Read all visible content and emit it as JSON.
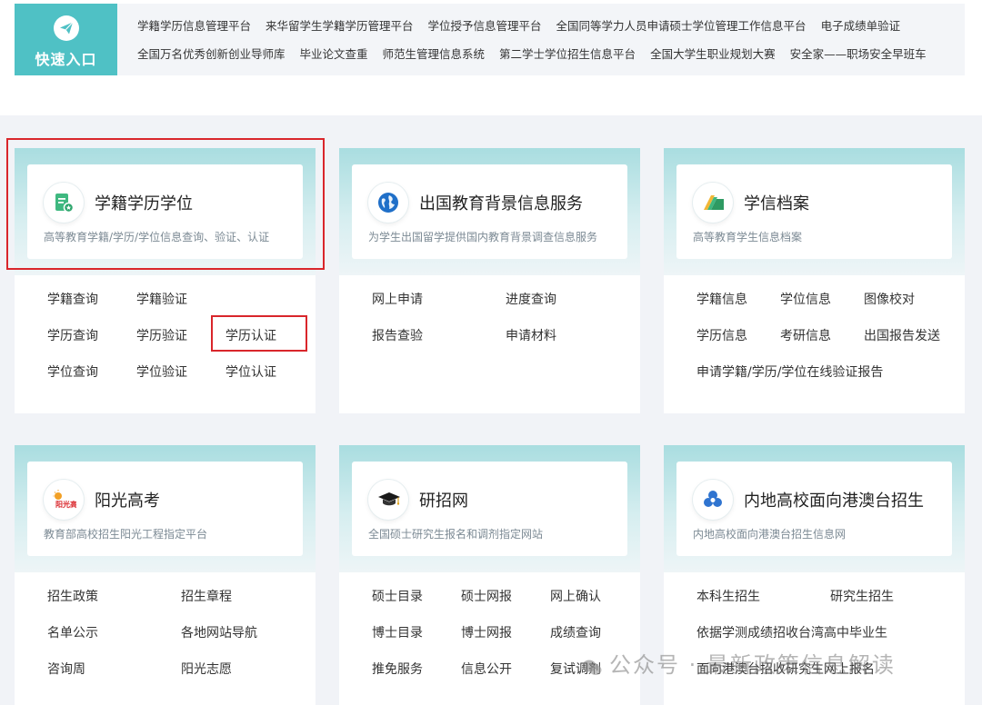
{
  "quick_entry": {
    "label": "快速入口",
    "rows": [
      [
        "学籍学历信息管理平台",
        "来华留学生学籍学历管理平台",
        "学位授予信息管理平台",
        "全国同等学力人员申请硕士学位管理工作信息平台",
        "电子成绩单验证"
      ],
      [
        "全国万名优秀创新创业导师库",
        "毕业论文查重",
        "师范生管理信息系统",
        "第二学士学位招生信息平台",
        "全国大学生职业规划大赛",
        "安全家——职场安全早班车"
      ]
    ]
  },
  "cards": [
    {
      "title": "学籍学历学位",
      "subtitle": "高等教育学籍/学历/学位信息查询、验证、认证",
      "icon": "document-badge-icon",
      "links": [
        "学籍查询",
        "学籍验证",
        "学历查询",
        "学历验证",
        "学历认证",
        "学位查询",
        "学位验证",
        "学位认证"
      ]
    },
    {
      "title": "出国教育背景信息服务",
      "subtitle": "为学生出国留学提供国内教育背景调查信息服务",
      "icon": "globe-icon",
      "links": [
        "网上申请",
        "进度查询",
        "报告查验",
        "申请材料"
      ]
    },
    {
      "title": "学信档案",
      "subtitle": "高等教育学生信息档案",
      "icon": "folder-stack-icon",
      "links": [
        "学籍信息",
        "学位信息",
        "图像校对",
        "学历信息",
        "考研信息",
        "出国报告发送",
        "申请学籍/学历/学位在线验证报告"
      ]
    },
    {
      "title": "阳光高考",
      "subtitle": "教育部高校招生阳光工程指定平台",
      "icon": "sunshine-gaokao-logo-icon",
      "logo_text": "阳光高考",
      "links": [
        "招生政策",
        "招生章程",
        "名单公示",
        "各地网站导航",
        "咨询周",
        "阳光志愿"
      ]
    },
    {
      "title": "研招网",
      "subtitle": "全国硕士研究生报名和调剂指定网站",
      "icon": "graduation-cap-icon",
      "links": [
        "硕士目录",
        "硕士网报",
        "网上确认",
        "博士目录",
        "博士网报",
        "成绩查询",
        "推免服务",
        "信息公开",
        "复试调剂"
      ]
    },
    {
      "title": "内地高校面向港澳台招生",
      "subtitle": "内地高校面向港澳台招生信息网",
      "icon": "flower-cluster-icon",
      "links": [
        "本科生招生",
        "研究生招生",
        "依据学测成绩招收台湾高中毕业生",
        "面向港澳台招收研究生网上报名"
      ]
    }
  ],
  "watermark": "公众号 · 最新政策信息解读",
  "colors": {
    "accent": "#4fc1c5",
    "highlight": "#d9262b"
  }
}
